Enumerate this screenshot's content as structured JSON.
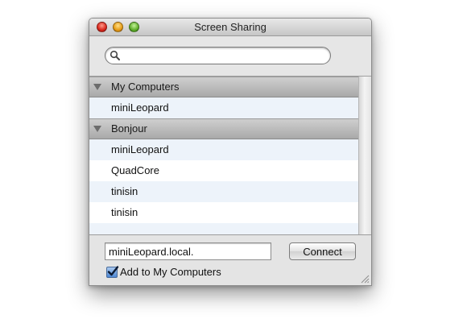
{
  "window": {
    "title": "Screen Sharing"
  },
  "search": {
    "value": "",
    "placeholder": ""
  },
  "groups": [
    {
      "label": "My Computers",
      "items": [
        "miniLeopard"
      ]
    },
    {
      "label": "Bonjour",
      "items": [
        "miniLeopard",
        "QuadCore",
        "tinisin",
        "tinisin"
      ]
    }
  ],
  "footer": {
    "address_value": "miniLeopard.local.",
    "connect_label": "Connect",
    "add_checkbox_label": "Add to My Computers",
    "add_checkbox_checked": true
  },
  "colors": {
    "row_alt": "#edf3fa",
    "close": "#d8261b",
    "minimize": "#e59b16",
    "zoom": "#5fae2a"
  },
  "icons": [
    "close-button",
    "minimize-button",
    "zoom-button",
    "search-icon",
    "disclosure-triangle-icon",
    "checkmark-icon",
    "resize-grip-icon"
  ]
}
